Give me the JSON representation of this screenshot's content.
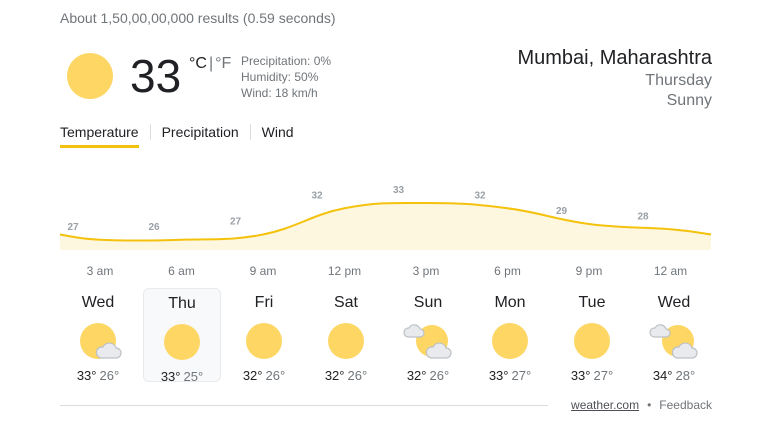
{
  "results_stats": "About 1,50,00,00,000 results (0.59 seconds)",
  "current": {
    "icon": "sun-icon",
    "temperature": "33",
    "unit_c": "°C",
    "unit_sep": "|",
    "unit_f": "°F",
    "precipitation": "Precipitation: 0%",
    "humidity": "Humidity: 50%",
    "wind": "Wind: 18 km/h"
  },
  "location": {
    "city": "Mumbai, Maharashtra",
    "day": "Thursday",
    "condition": "Sunny"
  },
  "tabs": [
    {
      "label": "Temperature",
      "active": true
    },
    {
      "label": "Precipitation",
      "active": false
    },
    {
      "label": "Wind",
      "active": false
    }
  ],
  "colors": {
    "accent": "#f4c20d",
    "sun": "#fdd663",
    "chart_line": "#f4c20d",
    "chart_fill": "#fef7e0"
  },
  "chart_data": {
    "type": "area",
    "x": [
      "12 am",
      "3 am",
      "6 am",
      "9 am",
      "12 pm",
      "3 pm",
      "6 pm",
      "9 pm",
      "12 am",
      "3 am"
    ],
    "values": [
      27,
      26,
      26,
      27,
      32,
      33,
      32,
      29,
      28,
      27
    ],
    "value_labels": [
      "27",
      "26",
      "27",
      "32",
      "33",
      "32",
      "29",
      "28"
    ],
    "tick_labels": [
      "3 am",
      "6 am",
      "9 am",
      "12 pm",
      "3 pm",
      "6 pm",
      "9 pm",
      "12 am"
    ],
    "ylim": [
      20,
      34
    ]
  },
  "forecast": [
    {
      "day": "Wed",
      "icon": "partly-sunny-icon",
      "hi": "33°",
      "lo": "26°"
    },
    {
      "day": "Thu",
      "icon": "sun-icon",
      "hi": "33°",
      "lo": "25°",
      "selected": true
    },
    {
      "day": "Fri",
      "icon": "sun-icon",
      "hi": "32°",
      "lo": "26°"
    },
    {
      "day": "Sat",
      "icon": "sun-icon",
      "hi": "32°",
      "lo": "26°"
    },
    {
      "day": "Sun",
      "icon": "partly-cloudy-icon",
      "hi": "32°",
      "lo": "26°"
    },
    {
      "day": "Mon",
      "icon": "sun-icon",
      "hi": "33°",
      "lo": "27°"
    },
    {
      "day": "Tue",
      "icon": "sun-icon",
      "hi": "33°",
      "lo": "27°"
    },
    {
      "day": "Wed",
      "icon": "partly-cloudy-icon",
      "hi": "34°",
      "lo": "28°"
    }
  ],
  "footer": {
    "source": "weather.com",
    "separator": "•",
    "feedback": "Feedback"
  }
}
